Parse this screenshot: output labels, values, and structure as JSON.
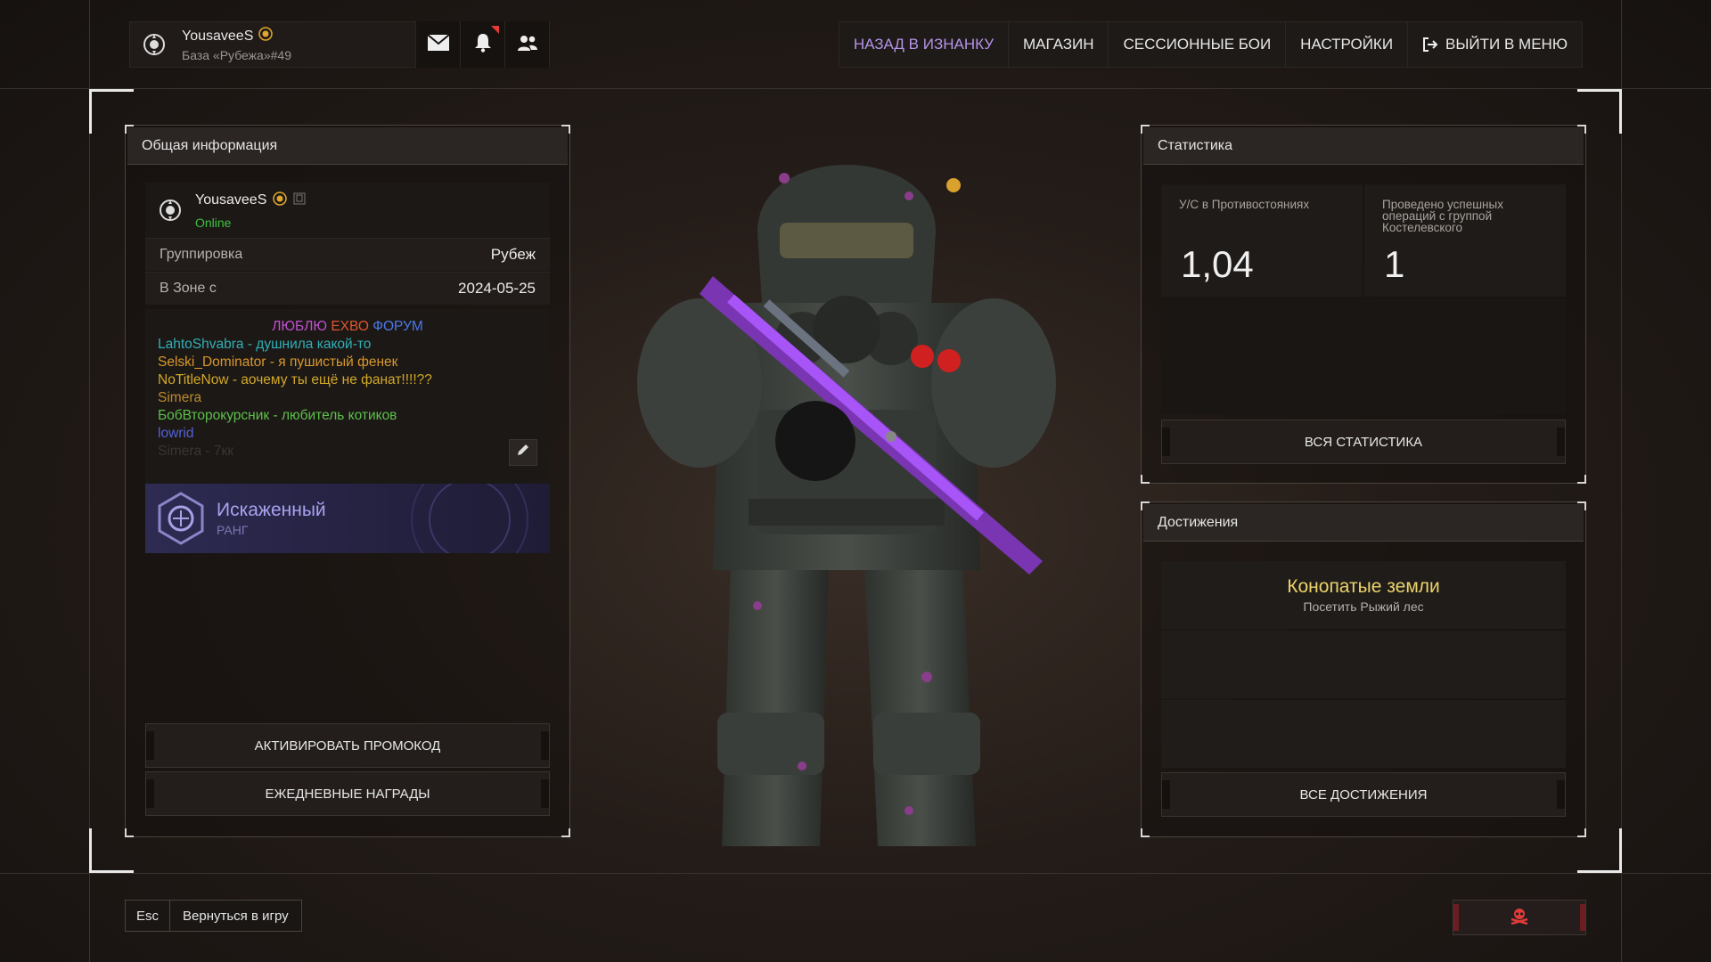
{
  "profile": {
    "username": "YousaveeS",
    "base": "База «Рубежа»#49",
    "status": "Online"
  },
  "topnav": {
    "items": [
      {
        "label": "НАЗАД В ИЗНАНКУ",
        "active": true
      },
      {
        "label": "МАГАЗИН",
        "active": false
      },
      {
        "label": "СЕССИОННЫЕ БОИ",
        "active": false
      },
      {
        "label": "НАСТРОЙКИ",
        "active": false
      },
      {
        "label": "ВЫЙТИ В МЕНЮ",
        "active": false
      }
    ]
  },
  "general": {
    "title": "Общая информация",
    "faction_label": "Группировка",
    "faction_value": "Рубеж",
    "zone_label": "В Зоне с",
    "zone_value": "2024-05-25",
    "bio": {
      "title_parts": [
        {
          "text": "ЛЮБЛЮ ",
          "color": "#c24fd0"
        },
        {
          "text": "ЕХВО ",
          "color": "#e0542c"
        },
        {
          "text": "ФОРУМ",
          "color": "#4d79e8"
        }
      ],
      "lines": [
        {
          "text": "LahtoShvabra - душнила какой-то",
          "color": "#2fb0b6"
        },
        {
          "text": "Selski_Dominator - я пушистый фенек",
          "color": "#d9982b"
        },
        {
          "text": "NoTitleNow - аочему ты ещё не фанат!!!!??",
          "color": "#d2a828"
        },
        {
          "text": "Simera",
          "color": "#bb8a2c"
        },
        {
          "text": "БобВторокурсник - любитель котиков",
          "color": "#5cc04a"
        },
        {
          "text": "lowrid",
          "color": "#5462d8"
        },
        {
          "text": "Simera - 7кк",
          "color": "#3a3532"
        }
      ]
    },
    "rank_name": "Искаженный",
    "rank_label": "РАНГ",
    "promo_button": "АКТИВИРОВАТЬ ПРОМОКОД",
    "daily_button": "ЕЖЕДНЕВНЫЕ НАГРАДЫ"
  },
  "stats": {
    "title": "Статистика",
    "items": [
      {
        "label": "У/С в Противостояниях",
        "value": "1,04"
      },
      {
        "label": "Проведено успешных операций с группой Костелевского",
        "value": "1"
      }
    ],
    "all_button": "ВСЯ СТАТИСТИКА"
  },
  "achievements": {
    "title": "Достижения",
    "items": [
      {
        "name": "Конопатые земли",
        "desc": "Посетить Рыжий лес"
      }
    ],
    "all_button": "ВСЕ ДОСТИЖЕНИЯ"
  },
  "footer": {
    "key": "Esc",
    "action": "Вернуться в игру"
  },
  "colors": {
    "accent": "#b693ea",
    "online": "#3ec23e",
    "achievement": "#ecd36b",
    "danger": "#e03a3a"
  }
}
